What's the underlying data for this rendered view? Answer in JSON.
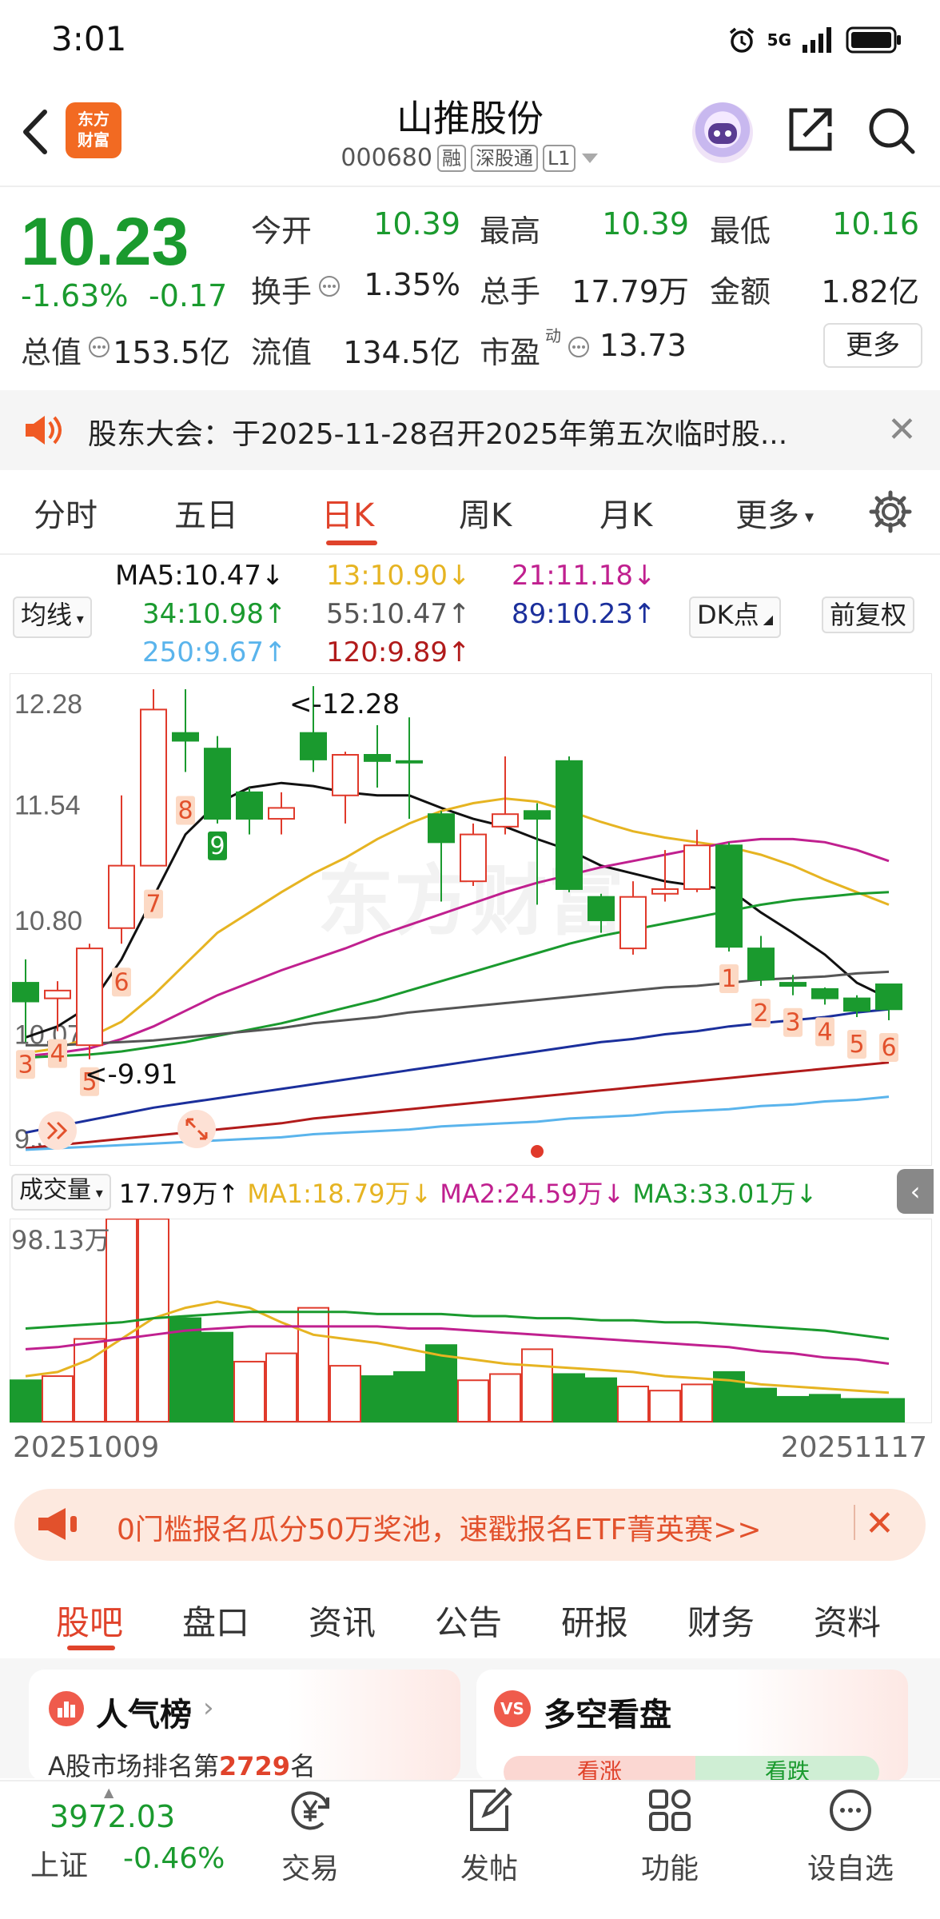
{
  "status": {
    "time": "3:01",
    "network": "5G"
  },
  "header": {
    "logo_line1": "东方",
    "logo_line2": "财富",
    "stock_name": "山推股份",
    "stock_code": "000680",
    "tags": [
      "融",
      "深股通",
      "L1"
    ]
  },
  "quote": {
    "price": "10.23",
    "pct_change": "-1.63%",
    "change": "-0.17",
    "open_label": "今开",
    "open": "10.39",
    "high_label": "最高",
    "high": "10.39",
    "low_label": "最低",
    "low": "10.16",
    "turnover_label": "换手",
    "turnover": "1.35%",
    "volume_label": "总手",
    "volume": "17.79万",
    "amount_label": "金额",
    "amount": "1.82亿",
    "mktcap_label": "总值",
    "mktcap": "153.5亿",
    "float_label": "流值",
    "float_cap": "134.5亿",
    "pe_label": "市盈",
    "pe_sup": "动",
    "pe": "13.73",
    "more_label": "更多",
    "colors": {
      "up": "#e03a2b",
      "down": "#1a9a2e"
    }
  },
  "notice": {
    "text": "股东大会：于2025-11-28召开2025年第五次临时股..."
  },
  "tabs": {
    "items": [
      "分时",
      "五日",
      "日K",
      "周K",
      "月K",
      "更多"
    ],
    "active": "日K"
  },
  "ma_legend": {
    "ma5": "MA5:10.47",
    "ma13": "13:10.90",
    "ma21": "21:11.18",
    "ma34": "34:10.98",
    "ma55": "55:10.47",
    "ma89": "89:10.23",
    "ma250": "250:9.67",
    "ma120": "120:9.89",
    "junxian": "均线",
    "dk": "DK点",
    "fuquan": "前复权",
    "colors": {
      "ma5": "#111111",
      "ma13": "#e6b422",
      "ma21": "#c0208f",
      "ma34": "#1a9a2e",
      "ma55": "#555555",
      "ma89": "#1b2f9c",
      "ma250": "#5ab4ec",
      "ma120": "#b11b1b"
    }
  },
  "chart_data": [
    {
      "type": "candlestick",
      "title": "",
      "y_ticks": [
        "12.28",
        "11.54",
        "10.80",
        "10.07",
        "9.33"
      ],
      "ylim": [
        9.33,
        12.28
      ],
      "max_label": "12.28",
      "min_label": "9.91",
      "candles": [
        {
          "o": 10.4,
          "c": 10.28,
          "h": 10.55,
          "l": 10.02
        },
        {
          "o": 10.3,
          "c": 10.35,
          "h": 10.41,
          "l": 10.09
        },
        {
          "o": 10.0,
          "c": 10.62,
          "h": 10.65,
          "l": 9.91
        },
        {
          "o": 10.75,
          "c": 11.15,
          "h": 11.6,
          "l": 10.65
        },
        {
          "o": 11.15,
          "c": 12.15,
          "h": 12.28,
          "l": 11.15
        },
        {
          "o": 12.0,
          "c": 11.95,
          "h": 12.28,
          "l": 11.75
        },
        {
          "o": 11.9,
          "c": 11.45,
          "h": 11.98,
          "l": 11.42
        },
        {
          "o": 11.62,
          "c": 11.45,
          "h": 11.65,
          "l": 11.35
        },
        {
          "o": 11.45,
          "c": 11.52,
          "h": 11.62,
          "l": 11.35
        },
        {
          "o": 12.0,
          "c": 11.83,
          "h": 12.3,
          "l": 11.75
        },
        {
          "o": 11.6,
          "c": 11.86,
          "h": 11.88,
          "l": 11.42
        },
        {
          "o": 11.86,
          "c": 11.82,
          "h": 12.05,
          "l": 11.65
        },
        {
          "o": 11.82,
          "c": 11.81,
          "h": 12.1,
          "l": 11.45
        },
        {
          "o": 11.48,
          "c": 11.3,
          "h": 11.5,
          "l": 10.92
        },
        {
          "o": 11.05,
          "c": 11.35,
          "h": 11.42,
          "l": 11.02
        },
        {
          "o": 11.4,
          "c": 11.48,
          "h": 11.85,
          "l": 11.35
        },
        {
          "o": 11.5,
          "c": 11.45,
          "h": 11.55,
          "l": 10.9
        },
        {
          "o": 11.82,
          "c": 11.0,
          "h": 11.85,
          "l": 10.98
        },
        {
          "o": 10.95,
          "c": 10.8,
          "h": 10.97,
          "l": 10.72
        },
        {
          "o": 10.62,
          "c": 10.95,
          "h": 11.05,
          "l": 10.58
        },
        {
          "o": 10.97,
          "c": 11.0,
          "h": 11.25,
          "l": 10.92
        },
        {
          "o": 11.0,
          "c": 11.28,
          "h": 11.38,
          "l": 10.98
        },
        {
          "o": 11.28,
          "c": 10.63,
          "h": 11.3,
          "l": 10.6
        },
        {
          "o": 10.62,
          "c": 10.42,
          "h": 10.7,
          "l": 10.38
        },
        {
          "o": 10.4,
          "c": 10.38,
          "h": 10.45,
          "l": 10.32
        },
        {
          "o": 10.36,
          "c": 10.3,
          "h": 10.37,
          "l": 10.26
        },
        {
          "o": 10.3,
          "c": 10.22,
          "h": 10.32,
          "l": 10.18
        },
        {
          "o": 10.39,
          "c": 10.23,
          "h": 10.39,
          "l": 10.16
        }
      ],
      "series": [
        {
          "name": "MA5",
          "color": "#111111",
          "values": [
            10.05,
            10.12,
            10.25,
            10.55,
            10.95,
            11.35,
            11.55,
            11.65,
            11.68,
            11.66,
            11.62,
            11.6,
            11.6,
            11.52,
            11.45,
            11.4,
            11.32,
            11.25,
            11.15,
            11.1,
            11.05,
            11.02,
            11.0,
            10.85,
            10.72,
            10.58,
            10.4,
            10.3
          ]
        },
        {
          "name": "MA13",
          "color": "#e6b422",
          "values": [
            9.95,
            9.98,
            10.05,
            10.15,
            10.32,
            10.52,
            10.72,
            10.85,
            10.98,
            11.1,
            11.2,
            11.32,
            11.42,
            11.5,
            11.55,
            11.58,
            11.56,
            11.5,
            11.43,
            11.37,
            11.33,
            11.3,
            11.27,
            11.22,
            11.15,
            11.06,
            10.98,
            10.9
          ]
        },
        {
          "name": "MA21",
          "color": "#c0208f",
          "values": [
            9.93,
            9.95,
            9.98,
            10.04,
            10.12,
            10.22,
            10.32,
            10.4,
            10.48,
            10.55,
            10.62,
            10.7,
            10.77,
            10.84,
            10.91,
            10.98,
            11.04,
            11.09,
            11.14,
            11.18,
            11.22,
            11.26,
            11.3,
            11.32,
            11.32,
            11.3,
            11.25,
            11.18
          ]
        },
        {
          "name": "MA34",
          "color": "#1a9a2e",
          "values": [
            9.92,
            9.93,
            9.94,
            9.96,
            9.99,
            10.02,
            10.06,
            10.1,
            10.14,
            10.19,
            10.24,
            10.29,
            10.35,
            10.41,
            10.47,
            10.53,
            10.59,
            10.65,
            10.7,
            10.74,
            10.78,
            10.82,
            10.86,
            10.9,
            10.93,
            10.95,
            10.97,
            10.98
          ]
        },
        {
          "name": "MA55",
          "color": "#555555",
          "values": [
            10.0,
            10.0,
            10.01,
            10.02,
            10.03,
            10.05,
            10.07,
            10.09,
            10.11,
            10.14,
            10.16,
            10.18,
            10.21,
            10.23,
            10.25,
            10.27,
            10.29,
            10.31,
            10.33,
            10.35,
            10.37,
            10.38,
            10.4,
            10.42,
            10.43,
            10.44,
            10.46,
            10.47
          ]
        },
        {
          "name": "MA89",
          "color": "#1b2f9c",
          "values": [
            9.44,
            9.48,
            9.52,
            9.56,
            9.6,
            9.63,
            9.66,
            9.69,
            9.72,
            9.75,
            9.78,
            9.81,
            9.84,
            9.87,
            9.9,
            9.93,
            9.96,
            9.99,
            10.02,
            10.04,
            10.07,
            10.09,
            10.12,
            10.14,
            10.16,
            10.18,
            10.21,
            10.23
          ]
        },
        {
          "name": "MA120",
          "color": "#b11b1b",
          "values": [
            9.34,
            9.36,
            9.38,
            9.4,
            9.42,
            9.44,
            9.46,
            9.48,
            9.5,
            9.53,
            9.55,
            9.57,
            9.59,
            9.61,
            9.63,
            9.65,
            9.67,
            9.69,
            9.71,
            9.73,
            9.75,
            9.77,
            9.79,
            9.81,
            9.83,
            9.85,
            9.87,
            9.89
          ]
        },
        {
          "name": "MA250",
          "color": "#5ab4ec",
          "values": [
            9.33,
            9.34,
            9.35,
            9.36,
            9.37,
            9.38,
            9.39,
            9.4,
            9.41,
            9.43,
            9.44,
            9.45,
            9.46,
            9.48,
            9.49,
            9.5,
            9.51,
            9.53,
            9.54,
            9.55,
            9.57,
            9.58,
            9.59,
            9.61,
            9.62,
            9.64,
            9.65,
            9.67
          ]
        }
      ],
      "markers": [
        {
          "index": 0,
          "label": "3"
        },
        {
          "index": 1,
          "label": "4"
        },
        {
          "index": 2,
          "label": "5"
        },
        {
          "index": 3,
          "label": "6"
        },
        {
          "index": 4,
          "label": "7"
        },
        {
          "index": 5,
          "label": "8"
        },
        {
          "index": 6,
          "label": "9",
          "style": "green"
        },
        {
          "index": 22,
          "label": "1"
        },
        {
          "index": 23,
          "label": "2"
        },
        {
          "index": 24,
          "label": "3"
        },
        {
          "index": 25,
          "label": "4"
        },
        {
          "index": 26,
          "label": "5"
        },
        {
          "index": 27,
          "label": "6"
        }
      ]
    },
    {
      "type": "bar",
      "title": "",
      "ylim": [
        0,
        98.13
      ],
      "y_ticks": [
        "98.13万"
      ],
      "x_ticks": [
        "20251009",
        "20251117"
      ],
      "values": [
        20,
        22,
        40,
        98,
        98,
        50,
        43,
        29,
        33,
        55,
        27,
        22,
        24,
        37,
        20,
        23,
        35,
        23,
        21,
        17,
        15,
        18,
        24,
        16,
        12,
        13,
        11,
        11
      ],
      "up": [
        false,
        true,
        true,
        true,
        true,
        false,
        false,
        true,
        true,
        true,
        true,
        false,
        false,
        false,
        true,
        true,
        true,
        false,
        false,
        true,
        true,
        true,
        false,
        false,
        false,
        false,
        false,
        false
      ],
      "series": [
        {
          "name": "MA1",
          "color": "#e6b422",
          "values": [
            22,
            24,
            30,
            40,
            50,
            55,
            58,
            55,
            48,
            42,
            40,
            38,
            35,
            32,
            30,
            28,
            27,
            26,
            25,
            24,
            22,
            21,
            20,
            18,
            17,
            16,
            15,
            14
          ]
        },
        {
          "name": "MA2",
          "color": "#c0208f",
          "values": [
            35,
            36,
            38,
            40,
            42,
            44,
            45,
            46,
            46,
            46,
            46,
            46,
            45,
            45,
            44,
            43,
            42,
            41,
            40,
            39,
            38,
            37,
            36,
            34,
            33,
            31,
            30,
            28
          ]
        },
        {
          "name": "MA3",
          "color": "#1a9a2e",
          "values": [
            45,
            46,
            47,
            48,
            50,
            51,
            52,
            53,
            53,
            53,
            53,
            52,
            52,
            52,
            51,
            51,
            50,
            50,
            49,
            49,
            48,
            48,
            47,
            46,
            45,
            44,
            42,
            40
          ]
        }
      ]
    }
  ],
  "volume_header": {
    "label": "成交量",
    "value": "17.79万",
    "ma1": "MA1:18.79万",
    "ma2": "MA2:24.59万",
    "ma3": "MA3:33.01万"
  },
  "ad": {
    "text": "0门槛报名瓜分50万奖池，速戳报名ETF菁英赛>>"
  },
  "bottom_tabs": {
    "items": [
      "股吧",
      "盘口",
      "资讯",
      "公告",
      "研报",
      "财务",
      "资料"
    ],
    "active": "股吧"
  },
  "cards": {
    "rank_title": "人气榜",
    "rank_prefix": "A股市场排名第",
    "rank_num": "2729",
    "rank_suffix": "名",
    "vs_title": "多空看盘",
    "vs_badge": "VS",
    "bull": "看涨",
    "bear": "看跌"
  },
  "bottom_nav": {
    "index_value": "3972.03",
    "index_name": "上证",
    "index_pct": "-0.46%",
    "items": [
      "交易",
      "发帖",
      "功能",
      "设自选"
    ]
  }
}
